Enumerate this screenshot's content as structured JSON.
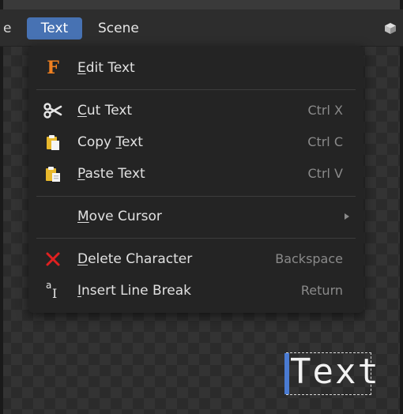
{
  "header": {
    "cut_label": "e",
    "menus": [
      {
        "label": "Text",
        "active": true
      },
      {
        "label": "Scene",
        "active": false
      }
    ]
  },
  "menu": {
    "items": [
      {
        "icon": "font-f-icon",
        "pre": "",
        "u": "E",
        "post": "dit Text",
        "shortcut": ""
      },
      {
        "icon": "scissors-icon",
        "pre": "",
        "u": "C",
        "post": "ut Text",
        "shortcut": "Ctrl X"
      },
      {
        "icon": "copy-clipboard-icon",
        "pre": "Copy ",
        "u": "T",
        "post": "ext",
        "shortcut": "Ctrl C"
      },
      {
        "icon": "paste-clipboard-icon",
        "pre": "",
        "u": "P",
        "post": "aste Text",
        "shortcut": "Ctrl V"
      },
      {
        "icon": "",
        "pre": "",
        "u": "M",
        "post": "ove Cursor",
        "shortcut": ""
      },
      {
        "icon": "x-delete-icon",
        "pre": "",
        "u": "D",
        "post": "elete Character",
        "shortcut": "Backspace"
      },
      {
        "icon": "line-break-icon",
        "pre": "",
        "u": "I",
        "post": "nsert Line Break",
        "shortcut": "Return"
      }
    ],
    "icon_glyphs": {
      "font": "F",
      "linebreak_a": "a",
      "linebreak_i": "I"
    }
  },
  "viewport": {
    "text_object_label": "Text"
  },
  "colors": {
    "accent": "#4772b3",
    "menu_bg": "#242424",
    "delete_red": "#e02020",
    "font_icon_orange": "#f08020"
  }
}
